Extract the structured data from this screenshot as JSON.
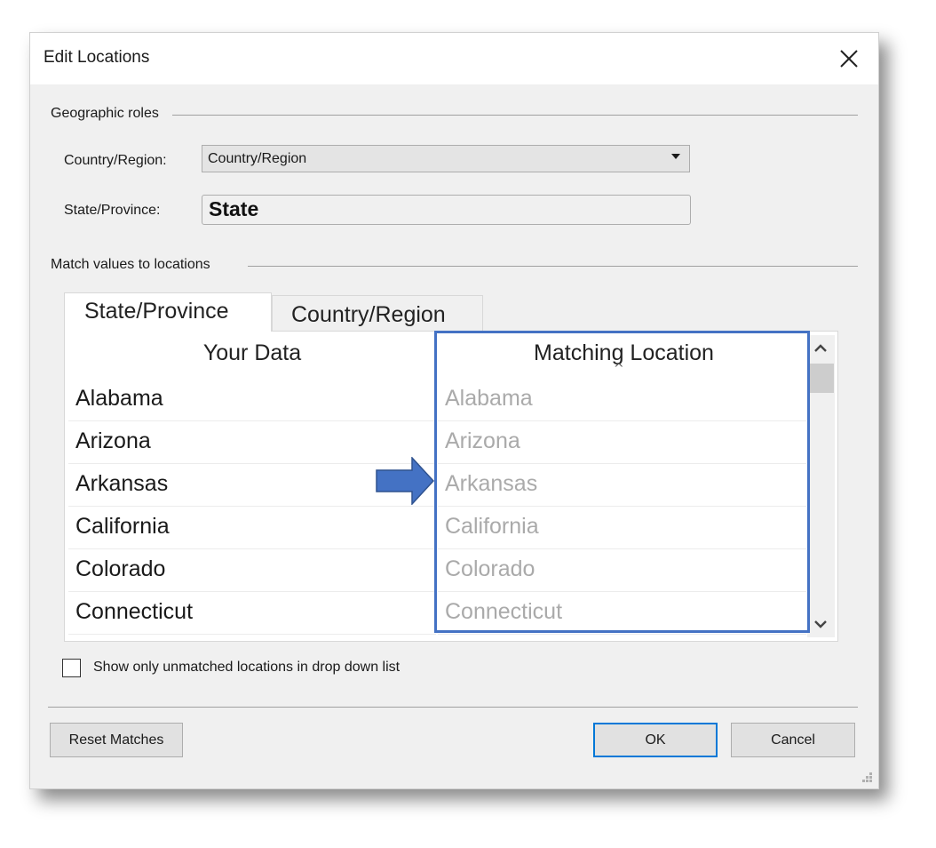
{
  "dialog": {
    "title": "Edit Locations",
    "close_icon": "close-icon"
  },
  "geographic_roles": {
    "group_label": "Geographic roles",
    "country_region": {
      "label": "Country/Region:",
      "selected_value": "Country/Region"
    },
    "state_province": {
      "label": "State/Province:",
      "value": "State"
    }
  },
  "match_values": {
    "group_label": "Match values to locations",
    "tabs": [
      {
        "label": "State/Province",
        "active": true
      },
      {
        "label": "Country/Region",
        "active": false
      }
    ],
    "columns": {
      "your_data": "Your Data",
      "matching_location": "Matching Location"
    },
    "rows": [
      {
        "your_data": "Alabama",
        "matching_location": "Alabama"
      },
      {
        "your_data": "Arizona",
        "matching_location": "Arizona"
      },
      {
        "your_data": "Arkansas",
        "matching_location": "Arkansas"
      },
      {
        "your_data": "California",
        "matching_location": "California"
      },
      {
        "your_data": "Colorado",
        "matching_location": "Colorado"
      },
      {
        "your_data": "Connecticut",
        "matching_location": "Connecticut"
      }
    ],
    "highlight_color": "#4472c4",
    "arrow_color": "#4472c4"
  },
  "checkbox": {
    "label": "Show only unmatched locations in drop down list",
    "checked": false
  },
  "buttons": {
    "reset": "Reset Matches",
    "ok": "OK",
    "cancel": "Cancel"
  }
}
